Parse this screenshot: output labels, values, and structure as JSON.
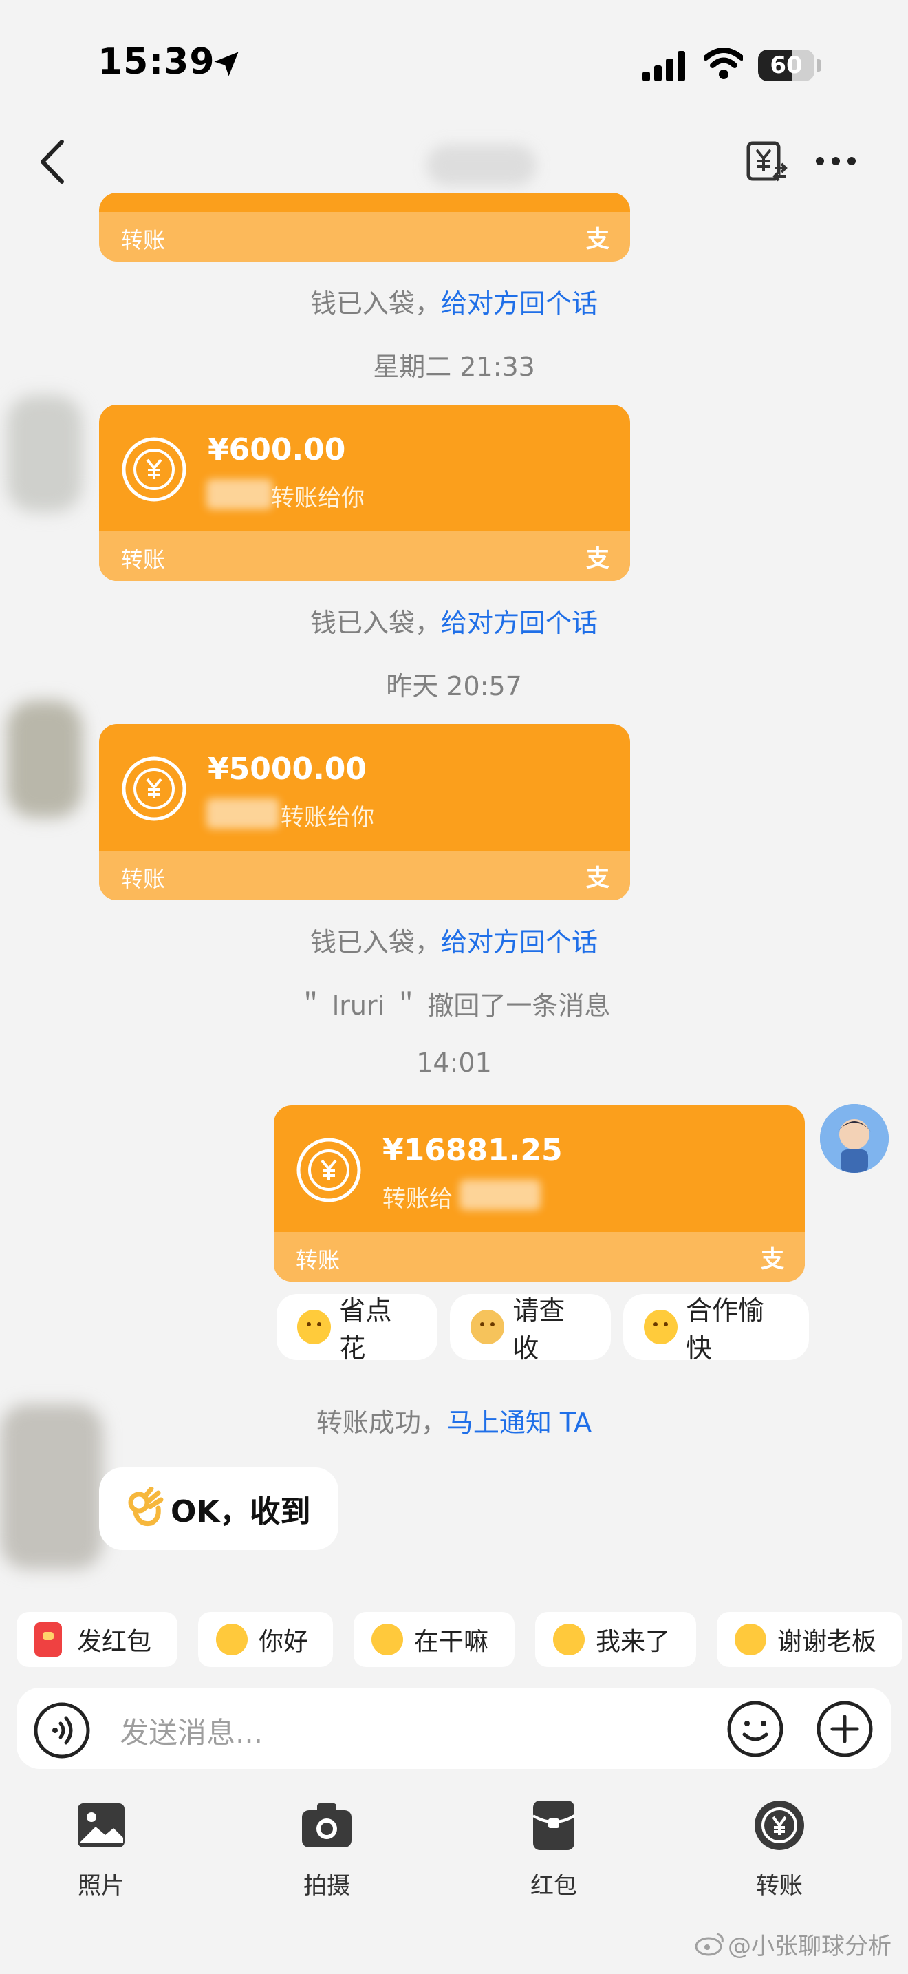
{
  "status_bar": {
    "time": "15:39",
    "battery": "60",
    "battery_level": 0.6
  },
  "header": {
    "title_redacted": true
  },
  "messages": {
    "card0": {
      "label": "转账",
      "pay_icon_glyph": "支"
    },
    "sys0": {
      "text": "钱已入袋，",
      "link": "给对方回个话"
    },
    "time1": "星期二 21:33",
    "card1": {
      "amount": "¥600.00",
      "sub": "转账给你",
      "label": "转账",
      "pay_icon_glyph": "支"
    },
    "sys1": {
      "text": "钱已入袋，",
      "link": "给对方回个话"
    },
    "time2": "昨天 20:57",
    "card2": {
      "amount": "¥5000.00",
      "sub": "转账给你",
      "label": "转账",
      "pay_icon_glyph": "支"
    },
    "sys2": {
      "text": "钱已入袋，",
      "link": "给对方回个话"
    },
    "recall": "＂ lruri ＂ 撤回了一条消息",
    "time3": "14:01",
    "card3": {
      "amount": "¥16881.25",
      "sub": "转账给",
      "label": "转账",
      "pay_icon_glyph": "支"
    },
    "quick_replies": [
      {
        "label": "省点花"
      },
      {
        "label": "请查收"
      },
      {
        "label": "合作愉快"
      }
    ],
    "sys3": {
      "text": "转账成功，",
      "link": "马上通知 TA"
    },
    "reply": {
      "text": "OK，收到"
    }
  },
  "chips": [
    {
      "label": "发红包",
      "icon": "red-packet-icon"
    },
    {
      "label": "你好",
      "icon": "emoji-icon"
    },
    {
      "label": "在干嘛",
      "icon": "emoji-icon"
    },
    {
      "label": "我来了",
      "icon": "emoji-icon"
    },
    {
      "label": "谢谢老板",
      "icon": "emoji-icon"
    }
  ],
  "input": {
    "placeholder": "发送消息..."
  },
  "toolbar": [
    {
      "label": "照片",
      "icon": "photo-icon"
    },
    {
      "label": "拍摄",
      "icon": "camera-icon"
    },
    {
      "label": "红包",
      "icon": "red-packet-icon"
    },
    {
      "label": "转账",
      "icon": "transfer-icon"
    }
  ],
  "watermark": "@小张聊球分析",
  "colors": {
    "card": "#fb9f1c",
    "card_footer": "#fcb95a",
    "link": "#1f6fe8",
    "background": "#f3f3f3"
  }
}
